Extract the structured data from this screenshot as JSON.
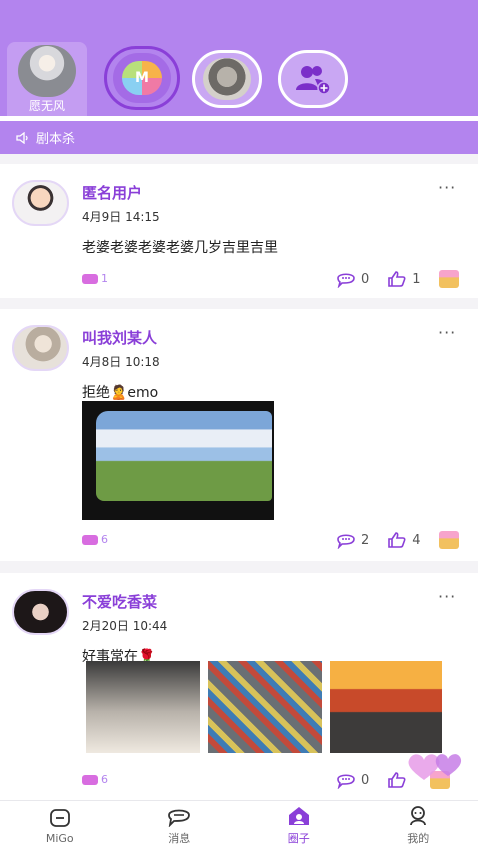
{
  "stories": {
    "self_label": "愿无风",
    "migo_logo": "M",
    "items": [
      {
        "name": "migo-story",
        "icon": "migo-logo-icon"
      },
      {
        "name": "cat-story",
        "icon": "cat-avatar-icon"
      },
      {
        "name": "add-friends",
        "icon": "add-users-icon"
      }
    ]
  },
  "channel": {
    "label": "剧本杀",
    "icon": "speaker-icon"
  },
  "posts": [
    {
      "username": "匿名用户",
      "date": "4月9日 14:15",
      "text": "老婆老婆老婆老婆几岁吉里吉里",
      "tag_count": "1",
      "comments": "0",
      "likes": "1"
    },
    {
      "username": "叫我刘某人",
      "date": "4月8日 10:18",
      "text": "拒绝🙎emo",
      "tag_count": "6",
      "comments": "2",
      "likes": "4"
    },
    {
      "username": "不爱吃香菜",
      "date": "2月20日 10:44",
      "text": "好事常在🌹",
      "tag_count": "6",
      "comments": "0",
      "likes": ""
    }
  ],
  "more_label": "···",
  "tabs": [
    {
      "label": "MiGo",
      "icon": "home-icon"
    },
    {
      "label": "消息",
      "icon": "message-icon"
    },
    {
      "label": "圈子",
      "icon": "circle-icon",
      "active": true
    },
    {
      "label": "我的",
      "icon": "profile-icon"
    }
  ],
  "colors": {
    "accent": "#b384ee",
    "accent_dark": "#8a3fd8"
  }
}
